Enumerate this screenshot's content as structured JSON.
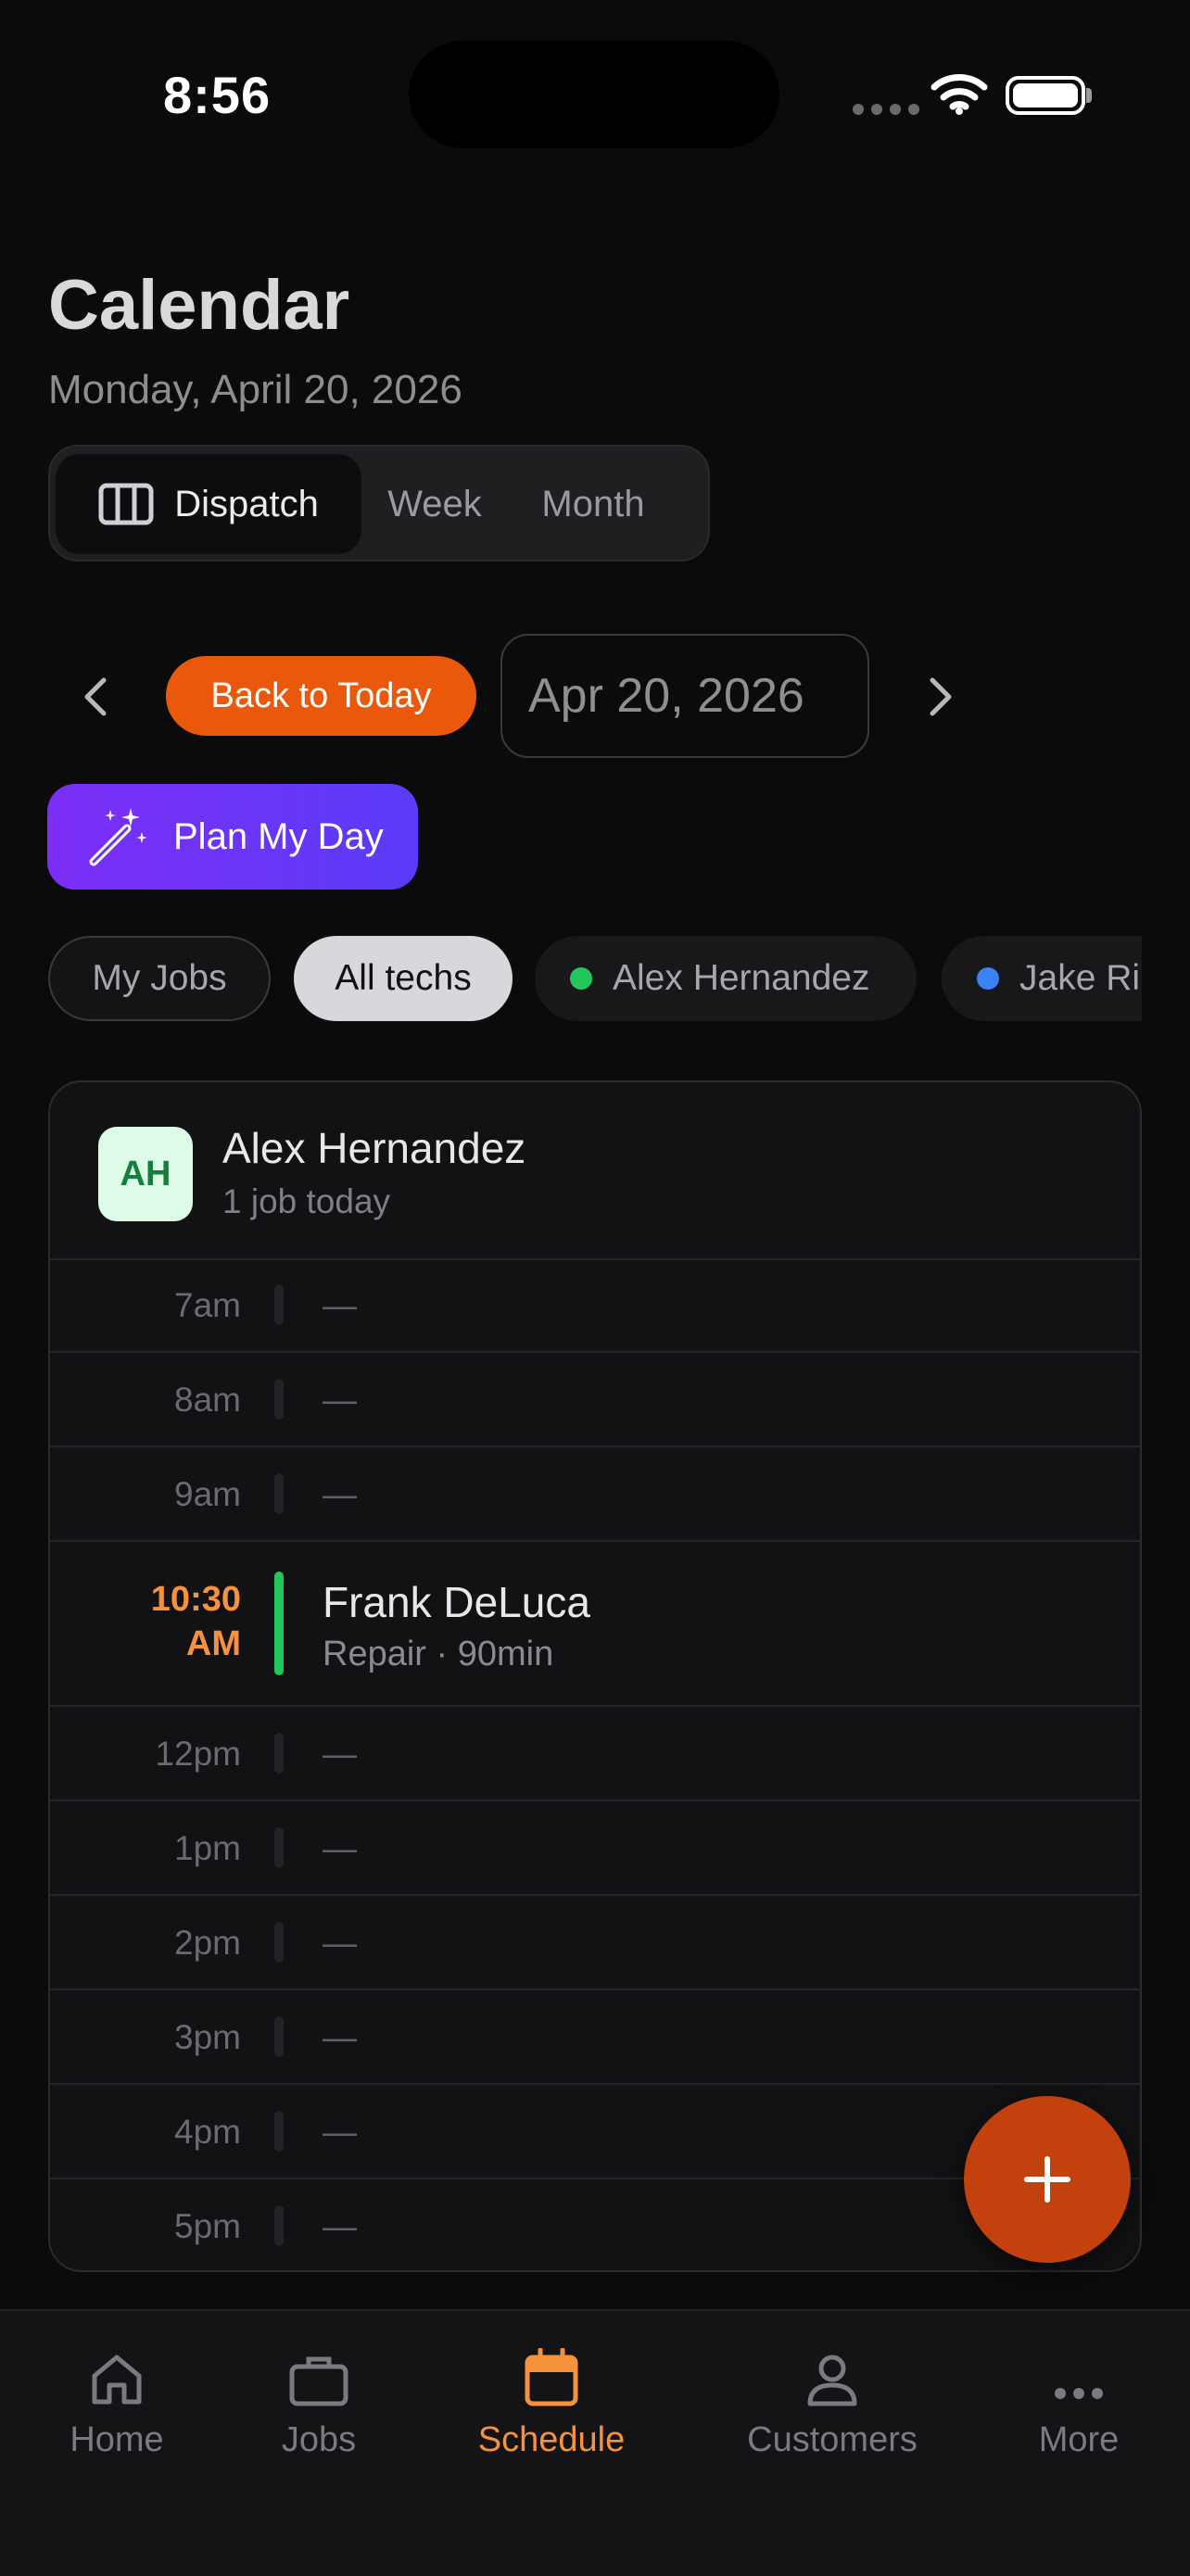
{
  "status_bar": {
    "time": "8:56"
  },
  "header": {
    "title": "Calendar",
    "date": "Monday, April 20, 2026"
  },
  "view_toggle": {
    "options": [
      "Dispatch",
      "Week",
      "Month"
    ],
    "selected": "Dispatch"
  },
  "nav": {
    "back_to_today": "Back to Today",
    "date_value": "Apr 20, 2026"
  },
  "plan_button": "Plan My Day",
  "filters": [
    {
      "label": "My Jobs",
      "style": "outline"
    },
    {
      "label": "All techs",
      "style": "selected"
    },
    {
      "label": "Alex Hernandez",
      "dot_color": "#22c55e"
    },
    {
      "label": "Jake Ri",
      "dot_color": "#3b82f6"
    }
  ],
  "tech": {
    "initials": "AH",
    "name": "Alex Hernandez",
    "summary": "1 job today",
    "slots": [
      {
        "time": "7am",
        "text": "—"
      },
      {
        "time": "8am",
        "text": "—"
      },
      {
        "time": "9am",
        "text": "—"
      },
      {
        "time": "10:30 AM",
        "time_line1": "10:30",
        "time_line2": "AM",
        "title": "Frank DeLuca",
        "detail": "Repair · 90min"
      },
      {
        "time": "12pm",
        "text": "—"
      },
      {
        "time": "1pm",
        "text": "—"
      },
      {
        "time": "2pm",
        "text": "—"
      },
      {
        "time": "3pm",
        "text": "—"
      },
      {
        "time": "4pm",
        "text": "—"
      },
      {
        "time": "5pm",
        "text": "—"
      }
    ]
  },
  "fab_icon": "plus-icon",
  "tabs": [
    {
      "label": "Home",
      "icon": "home-icon"
    },
    {
      "label": "Jobs",
      "icon": "briefcase-icon"
    },
    {
      "label": "Schedule",
      "icon": "calendar-icon",
      "active": true
    },
    {
      "label": "Customers",
      "icon": "person-icon"
    },
    {
      "label": "More",
      "icon": "more-icon"
    }
  ],
  "colors": {
    "accent": "#ea580c",
    "active_tab": "#f5923b",
    "plan_gradient": "#7c2ef5",
    "job_bar": "#22c55e"
  }
}
